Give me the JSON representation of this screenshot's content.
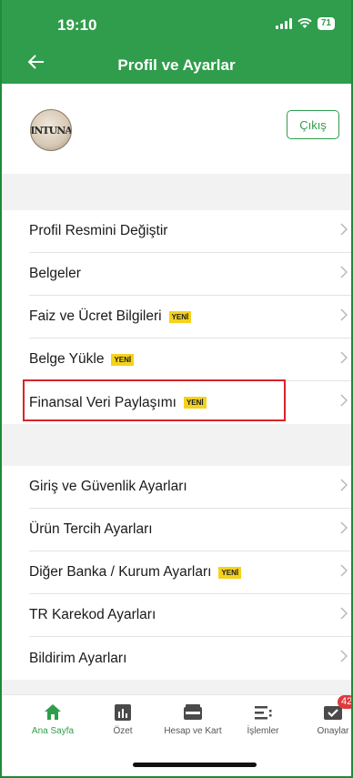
{
  "status_bar": {
    "time": "19:10",
    "battery": "71"
  },
  "header": {
    "title": "Profil ve Ayarlar"
  },
  "profile": {
    "avatar_text": "INTUNA",
    "logout_label": "Çıkış"
  },
  "badge_label": "YENİ",
  "section1": [
    {
      "label": "Profil Resmini Değiştir",
      "new": false
    },
    {
      "label": "Belgeler",
      "new": false
    },
    {
      "label": "Faiz ve Ücret Bilgileri",
      "new": true
    },
    {
      "label": "Belge Yükle",
      "new": true
    },
    {
      "label": "Finansal Veri Paylaşımı",
      "new": true
    }
  ],
  "section2": [
    {
      "label": "Giriş ve Güvenlik Ayarları",
      "new": false
    },
    {
      "label": "Ürün Tercih Ayarları",
      "new": false
    },
    {
      "label": "Diğer Banka / Kurum Ayarları",
      "new": true
    },
    {
      "label": "TR Karekod Ayarları",
      "new": false
    },
    {
      "label": "Bildirim Ayarları",
      "new": false
    }
  ],
  "tabs": [
    {
      "label": "Ana Sayfa",
      "icon": "home-icon",
      "active": true
    },
    {
      "label": "Özet",
      "icon": "bar-chart-icon",
      "active": false
    },
    {
      "label": "Hesap ve Kart",
      "icon": "wallet-icon",
      "active": false
    },
    {
      "label": "İşlemler",
      "icon": "list-icon",
      "active": false
    },
    {
      "label": "Onaylar",
      "icon": "approval-icon",
      "active": false,
      "badge": "42"
    }
  ],
  "colors": {
    "brand": "#2f9d4c",
    "badge": "#f5d21b",
    "highlight": "#d8232a"
  }
}
